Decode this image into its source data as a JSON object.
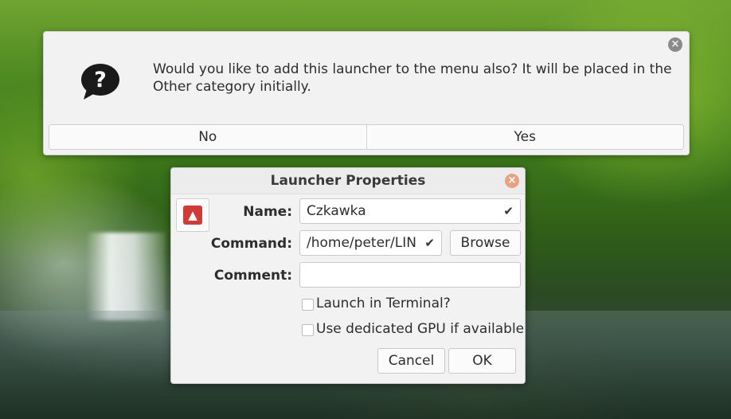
{
  "question_dialog": {
    "message": "Would you like to add this launcher to the menu also?  It will be placed in the Other category initially.",
    "buttons": {
      "no": "No",
      "yes": "Yes"
    },
    "close_glyph": "×",
    "icon": "question-bubble-icon"
  },
  "launcher_properties": {
    "title": "Launcher Properties",
    "close_glyph": "×",
    "app_icon": "rocket-app-icon",
    "name": {
      "label": "Name:",
      "value": "Czkawka"
    },
    "command": {
      "label": "Command:",
      "value": "/home/peter/LIN"
    },
    "comment": {
      "label": "Comment:",
      "value": ""
    },
    "browse_label": "Browse",
    "launch_in_terminal": {
      "label": "Launch in Terminal?",
      "checked": false
    },
    "dedicated_gpu": {
      "label": "Use dedicated GPU if available",
      "checked": false
    },
    "cancel_label": "Cancel",
    "ok_label": "OK",
    "check_glyph": "✔"
  }
}
